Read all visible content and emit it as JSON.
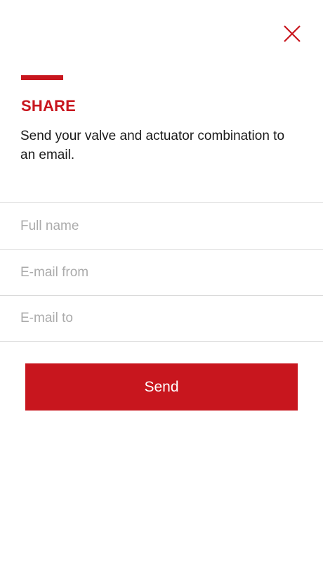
{
  "colors": {
    "accent": "#c8161e",
    "text": "#1a1a1a",
    "divider": "#d9d9d9",
    "placeholder": "#ababab",
    "button_text": "#ffffff",
    "background": "#ffffff"
  },
  "header": {
    "close_icon": "close-icon"
  },
  "share": {
    "title": "SHARE",
    "description": "Send your valve and actuator combination to an email."
  },
  "form": {
    "full_name": {
      "value": "",
      "placeholder": "Full name"
    },
    "email_from": {
      "value": "",
      "placeholder": "E-mail from"
    },
    "email_to": {
      "value": "",
      "placeholder": "E-mail to"
    }
  },
  "actions": {
    "send_label": "Send"
  }
}
